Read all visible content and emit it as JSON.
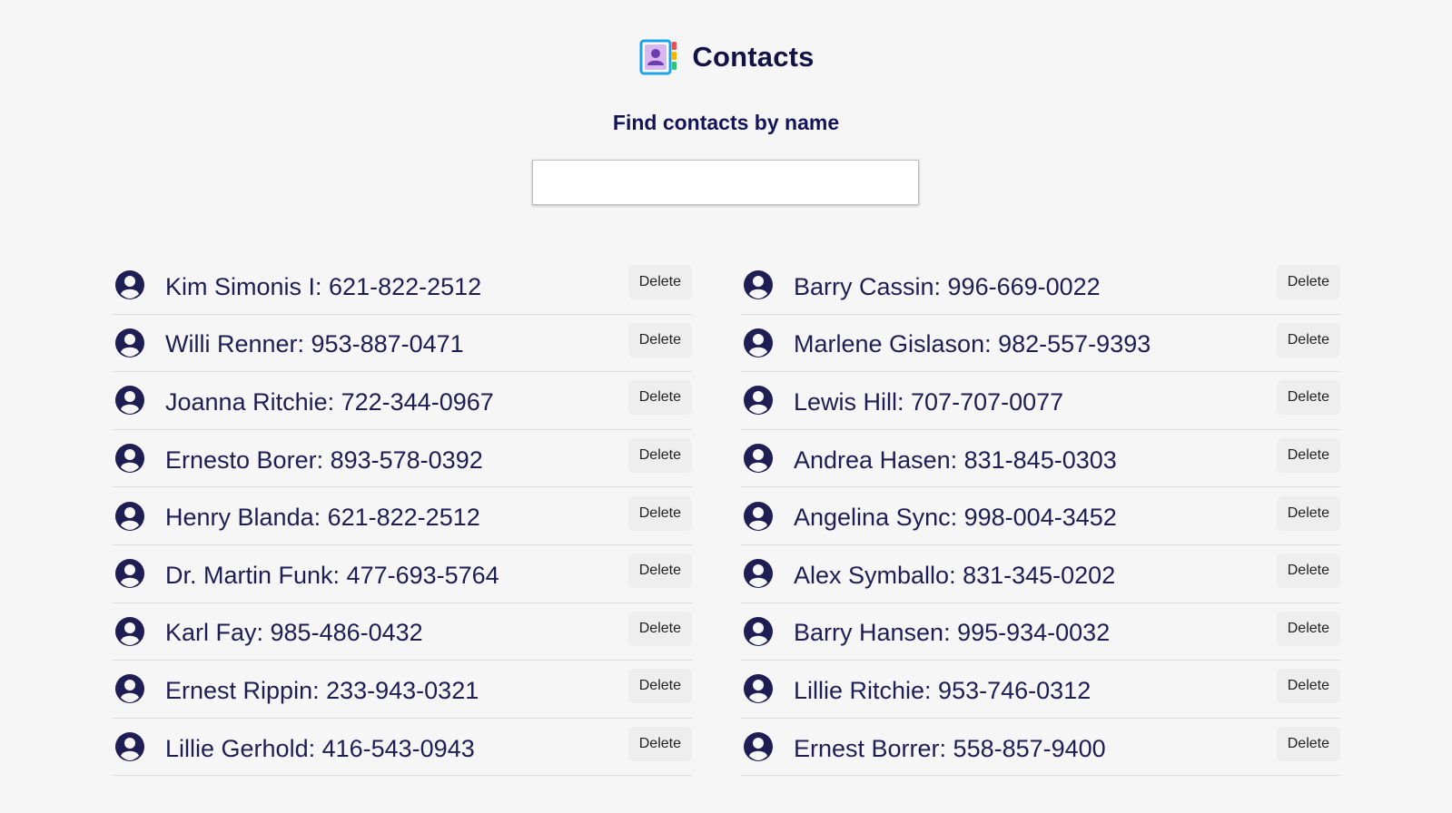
{
  "app": {
    "title": "Contacts"
  },
  "search": {
    "label": "Find contacts by name",
    "value": "",
    "placeholder": ""
  },
  "contacts_left": [
    {
      "text": "Kim Simonis I: 621-822-2512",
      "delete_label": "Delete"
    },
    {
      "text": "Willi Renner: 953-887-0471",
      "delete_label": "Delete"
    },
    {
      "text": "Joanna Ritchie: 722-344-0967",
      "delete_label": "Delete"
    },
    {
      "text": "Ernesto Borer: 893-578-0392",
      "delete_label": "Delete"
    },
    {
      "text": "Henry Blanda: 621-822-2512",
      "delete_label": "Delete"
    },
    {
      "text": "Dr. Martin Funk: 477-693-5764",
      "delete_label": "Delete"
    },
    {
      "text": "Karl Fay: 985-486-0432",
      "delete_label": "Delete"
    },
    {
      "text": "Ernest Rippin: 233-943-0321",
      "delete_label": "Delete"
    },
    {
      "text": "Lillie Gerhold: 416-543-0943",
      "delete_label": "Delete"
    }
  ],
  "contacts_right": [
    {
      "text": "Barry Cassin: 996-669-0022",
      "delete_label": "Delete"
    },
    {
      "text": "Marlene Gislason: 982-557-9393",
      "delete_label": "Delete"
    },
    {
      "text": "Lewis Hill: 707-707-0077",
      "delete_label": "Delete"
    },
    {
      "text": "Andrea Hasen: 831-845-0303",
      "delete_label": "Delete"
    },
    {
      "text": "Angelina Sync: 998-004-3452",
      "delete_label": "Delete"
    },
    {
      "text": "Alex Symballo: 831-345-0202",
      "delete_label": "Delete"
    },
    {
      "text": "Barry Hansen: 995-934-0032",
      "delete_label": "Delete"
    },
    {
      "text": "Lillie Ritchie: 953-746-0312",
      "delete_label": "Delete"
    },
    {
      "text": "Ernest Borrer: 558-857-9400",
      "delete_label": "Delete"
    }
  ],
  "icons": {
    "logo": "contacts-book-icon",
    "avatar": "user-circle-icon"
  },
  "colors": {
    "background": "#f6f6f6",
    "text": "#1e1e55",
    "title": "#121244",
    "button_bg": "#eeeeee"
  }
}
